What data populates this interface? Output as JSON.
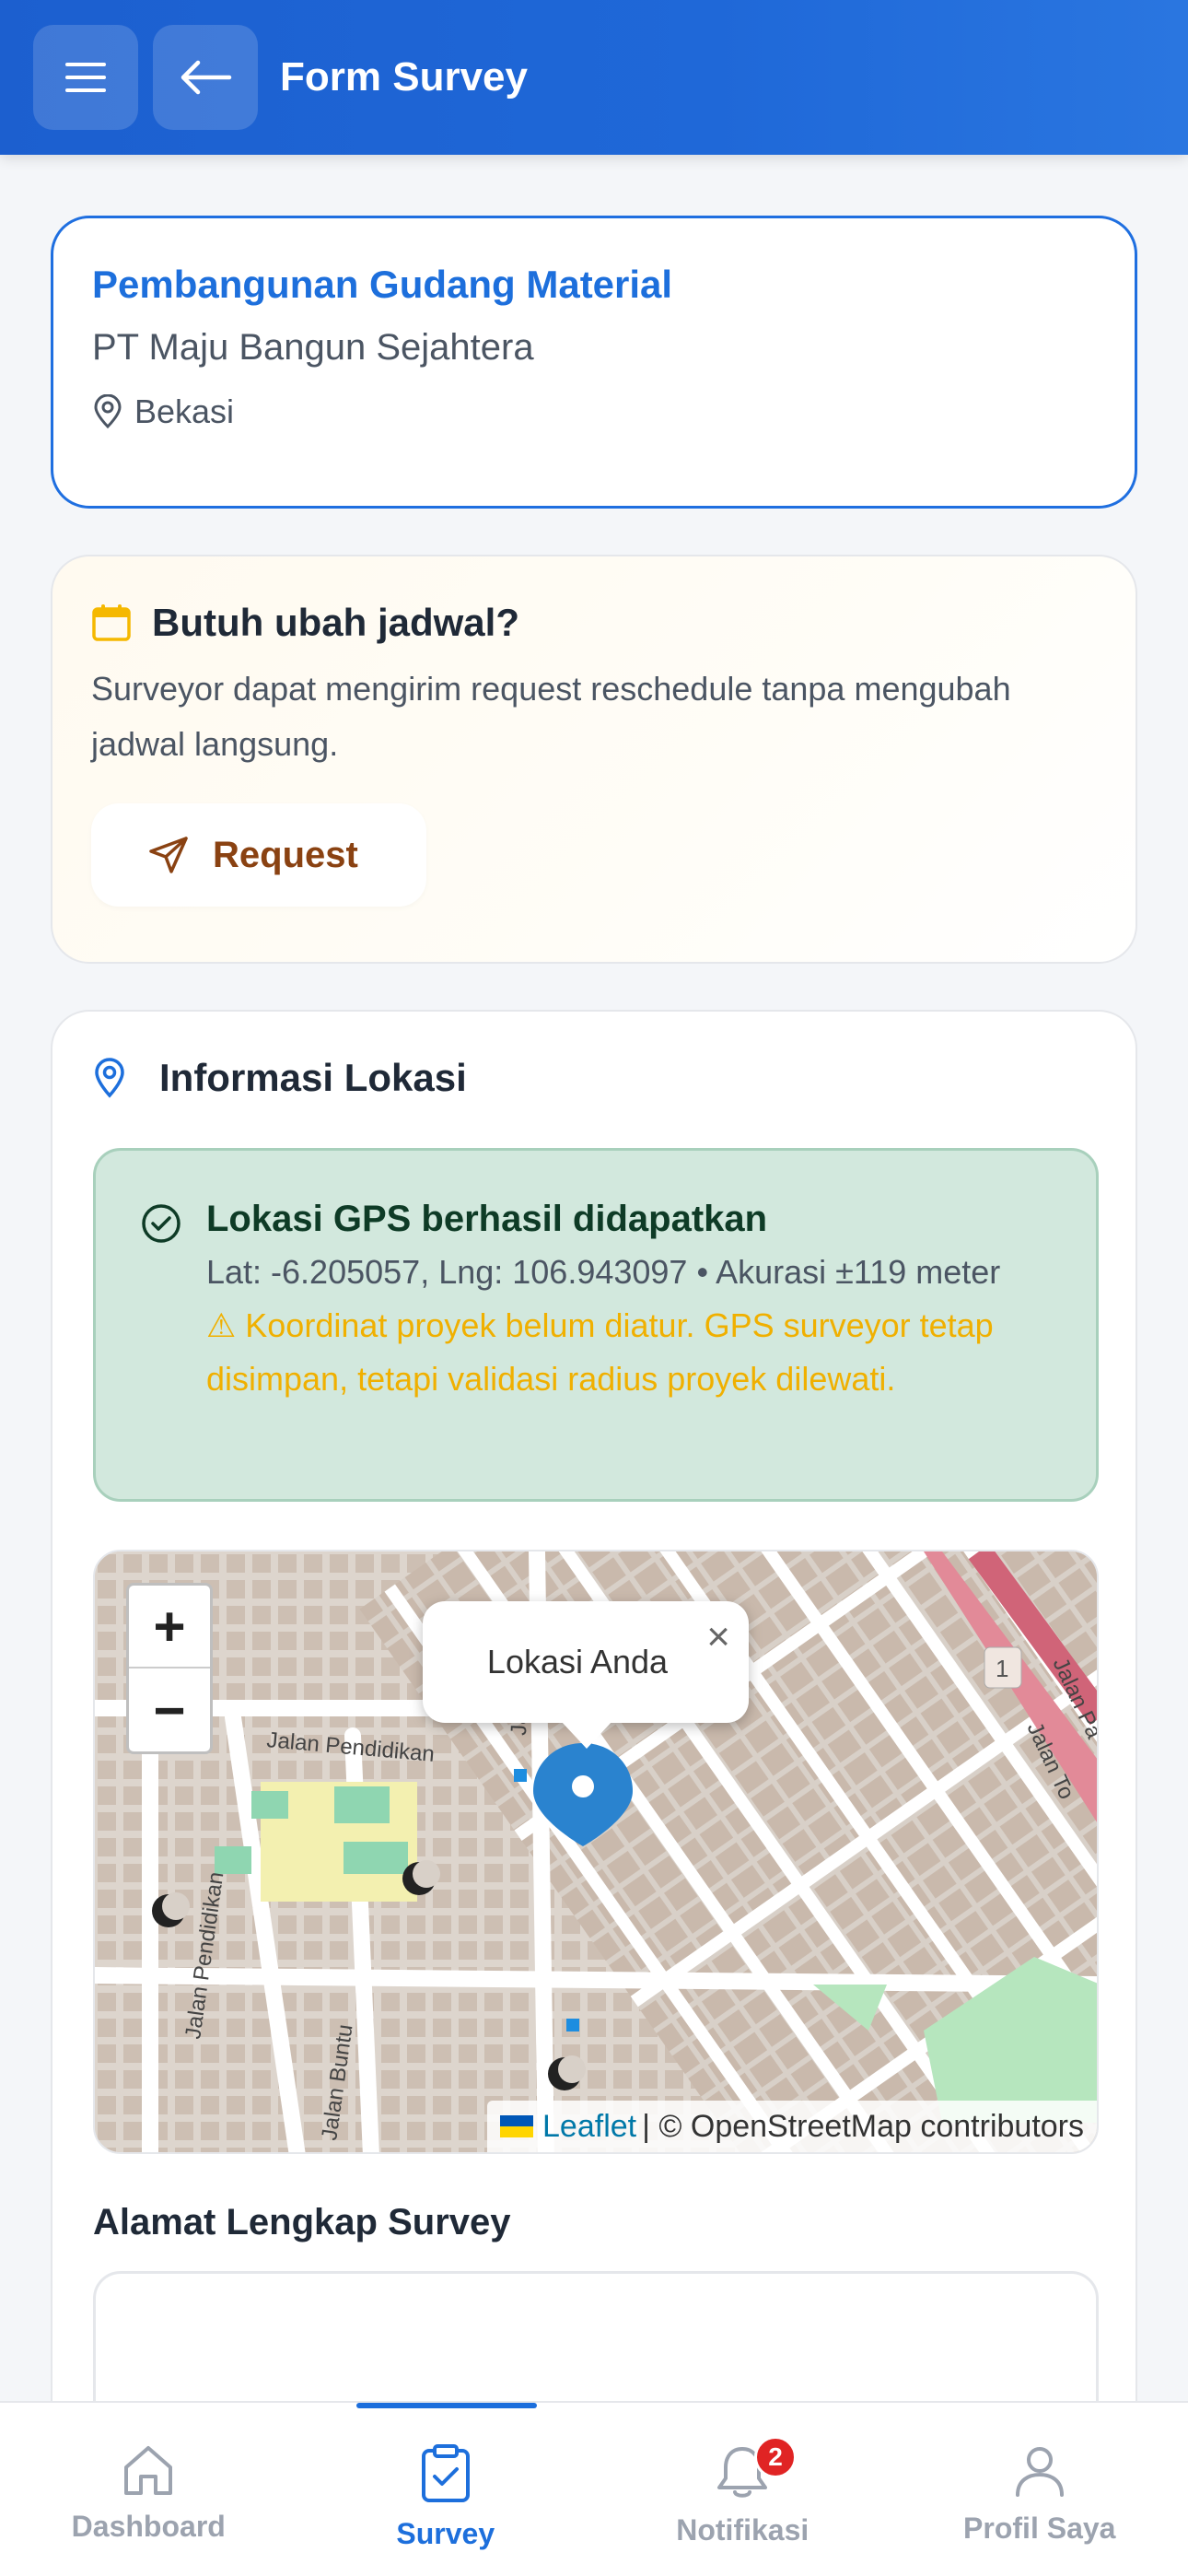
{
  "header": {
    "title": "Form Survey"
  },
  "project": {
    "name": "Pembangunan Gudang Material",
    "company": "PT Maju Bangun Sejahtera",
    "location": "Bekasi"
  },
  "reschedule": {
    "title": "Butuh ubah jadwal?",
    "description": "Surveyor dapat mengirim request reschedule tanpa mengubah jadwal langsung.",
    "button_label": "Request"
  },
  "location_info": {
    "title": "Informasi Lokasi",
    "gps_title": "Lokasi GPS berhasil didapatkan",
    "gps_coords": "Lat: -6.205057, Lng: 106.943097 • Akurasi ±119 meter",
    "gps_warning": "⚠ Koordinat proyek belum diatur. GPS surveyor tetap disimpan, tetapi validasi radius proyek dilewati."
  },
  "map": {
    "zoom_in": "+",
    "zoom_out": "−",
    "popup_text": "Lokasi Anda",
    "popup_close": "×",
    "attribution_leaflet": "Leaflet",
    "attribution_osm": "| © OpenStreetMap contributors",
    "street_labels": [
      "Jalan Pendidikan",
      "Jalan Pendidikan",
      "Jalan Buntu",
      "Jala",
      "Jalan Pa",
      "Jalan To",
      "1"
    ]
  },
  "address": {
    "label": "Alamat Lengkap Survey",
    "value": ""
  },
  "bottom_nav": {
    "items": [
      {
        "label": "Dashboard",
        "icon": "home-icon",
        "active": false
      },
      {
        "label": "Survey",
        "icon": "clipboard-check-icon",
        "active": true
      },
      {
        "label": "Notifikasi",
        "icon": "bell-icon",
        "active": false,
        "badge": "2"
      },
      {
        "label": "Profil Saya",
        "icon": "user-icon",
        "active": false
      }
    ]
  },
  "colors": {
    "primary": "#1d6fdc",
    "header": "#1f68d8",
    "success_bg": "#d2e8dd",
    "warning_text": "#f0b000",
    "request_text": "#8a4212",
    "badge": "#e02424"
  }
}
